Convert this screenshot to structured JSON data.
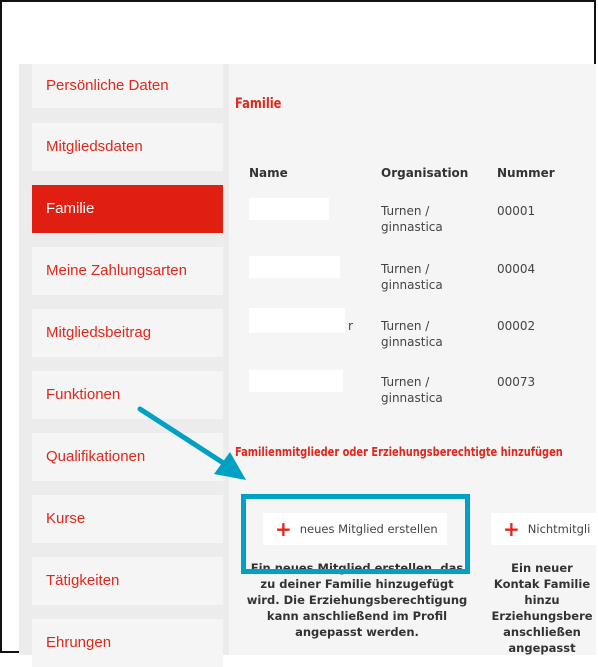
{
  "sidebar": {
    "items": [
      {
        "label": "Persönliche Daten",
        "active": false
      },
      {
        "label": "Mitgliedsdaten",
        "active": false
      },
      {
        "label": "Familie",
        "active": true
      },
      {
        "label": "Meine Zahlungsarten",
        "active": false
      },
      {
        "label": "Mitgliedsbeitrag",
        "active": false
      },
      {
        "label": "Funktionen",
        "active": false
      },
      {
        "label": "Qualifikationen",
        "active": false
      },
      {
        "label": "Kurse",
        "active": false
      },
      {
        "label": "Tätigkeiten",
        "active": false
      },
      {
        "label": "Ehrungen",
        "active": false
      }
    ]
  },
  "main": {
    "title": "Familie",
    "table": {
      "headers": {
        "name": "Name",
        "organisation": "Organisation",
        "nummer": "Nummer"
      },
      "rows": [
        {
          "name_suffix": "",
          "org": "Turnen / ginnastica",
          "nummer": "00001"
        },
        {
          "name_suffix": "",
          "org": "Turnen / ginnastica",
          "nummer": "00004"
        },
        {
          "name_suffix": "r",
          "org": "Turnen / ginnastica",
          "nummer": "00002"
        },
        {
          "name_suffix": "",
          "org": "Turnen / ginnastica",
          "nummer": "00073"
        }
      ]
    },
    "add_title": "Familienmitglieder oder Erziehungsberechtigte hinzufügen",
    "new_member": {
      "button_label": "neues Mitglied erstellen",
      "description": "Ein neues Mitglied erstellen, das zu deiner Familie hinzugefügt wird. Die Erziehungsberechtigung kann anschließend im Profil angepasst werden."
    },
    "non_member": {
      "button_label": "Nichtmitgli",
      "description": "Ein neuer Kontak Familie hinzu Erziehungsbere anschließen angepasst"
    }
  },
  "colors": {
    "accent": "#e0271b",
    "highlight": "#00a1c4",
    "active_bg": "#e01f12"
  }
}
